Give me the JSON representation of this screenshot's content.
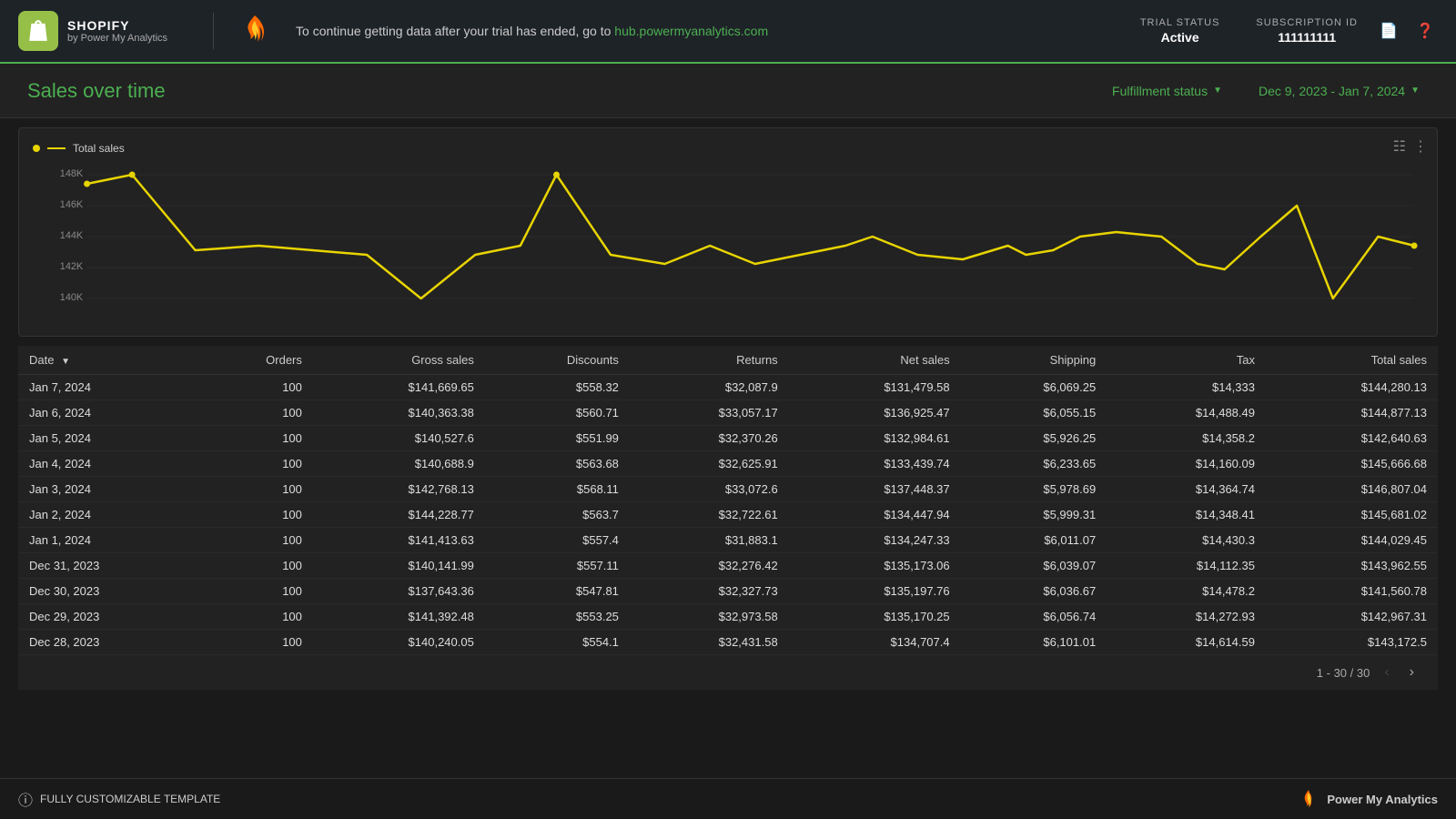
{
  "header": {
    "shopify_label": "SHOPIFY",
    "shopify_sub": "by Power My Analytics",
    "notice_text": "To continue getting data after your trial has ended, go to",
    "notice_link": "hub.powermyanalytics.com",
    "trial_status_label": "TRIAL STATUS",
    "trial_status_value": "Active",
    "subscription_id_label": "SUBSCRIPTION ID",
    "subscription_id_value": "111111111"
  },
  "subheader": {
    "page_title": "Sales over time",
    "filter1_label": "Fulfillment status",
    "filter2_label": "Dec 9, 2023 - Jan 7, 2024"
  },
  "chart": {
    "legend_label": "Total sales",
    "y_labels": [
      "148K",
      "146K",
      "144K",
      "142K",
      "140K"
    ]
  },
  "table": {
    "columns": [
      "Date",
      "Orders",
      "Gross sales",
      "Discounts",
      "Returns",
      "Net sales",
      "Shipping",
      "Tax",
      "Total sales"
    ],
    "rows": [
      [
        "Jan 7, 2024",
        "100",
        "$141,669.65",
        "$558.32",
        "$32,087.9",
        "$131,479.58",
        "$6,069.25",
        "$14,333",
        "$144,280.13"
      ],
      [
        "Jan 6, 2024",
        "100",
        "$140,363.38",
        "$560.71",
        "$33,057.17",
        "$136,925.47",
        "$6,055.15",
        "$14,488.49",
        "$144,877.13"
      ],
      [
        "Jan 5, 2024",
        "100",
        "$140,527.6",
        "$551.99",
        "$32,370.26",
        "$132,984.61",
        "$5,926.25",
        "$14,358.2",
        "$142,640.63"
      ],
      [
        "Jan 4, 2024",
        "100",
        "$140,688.9",
        "$563.68",
        "$32,625.91",
        "$133,439.74",
        "$6,233.65",
        "$14,160.09",
        "$145,666.68"
      ],
      [
        "Jan 3, 2024",
        "100",
        "$142,768.13",
        "$568.11",
        "$33,072.6",
        "$137,448.37",
        "$5,978.69",
        "$14,364.74",
        "$146,807.04"
      ],
      [
        "Jan 2, 2024",
        "100",
        "$144,228.77",
        "$563.7",
        "$32,722.61",
        "$134,447.94",
        "$5,999.31",
        "$14,348.41",
        "$145,681.02"
      ],
      [
        "Jan 1, 2024",
        "100",
        "$141,413.63",
        "$557.4",
        "$31,883.1",
        "$134,247.33",
        "$6,011.07",
        "$14,430.3",
        "$144,029.45"
      ],
      [
        "Dec 31, 2023",
        "100",
        "$140,141.99",
        "$557.11",
        "$32,276.42",
        "$135,173.06",
        "$6,039.07",
        "$14,112.35",
        "$143,962.55"
      ],
      [
        "Dec 30, 2023",
        "100",
        "$137,643.36",
        "$547.81",
        "$32,327.73",
        "$135,197.76",
        "$6,036.67",
        "$14,478.2",
        "$141,560.78"
      ],
      [
        "Dec 29, 2023",
        "100",
        "$141,392.48",
        "$553.25",
        "$32,973.58",
        "$135,170.25",
        "$6,056.74",
        "$14,272.93",
        "$142,967.31"
      ],
      [
        "Dec 28, 2023",
        "100",
        "$140,240.05",
        "$554.1",
        "$32,431.58",
        "$134,707.4",
        "$6,101.01",
        "$14,614.59",
        "$143,172.5"
      ]
    ],
    "pagination": "1 - 30 / 30"
  },
  "footer": {
    "customizable_label": "FULLY CUSTOMIZABLE TEMPLATE",
    "brand_label": "Power My Analytics"
  }
}
